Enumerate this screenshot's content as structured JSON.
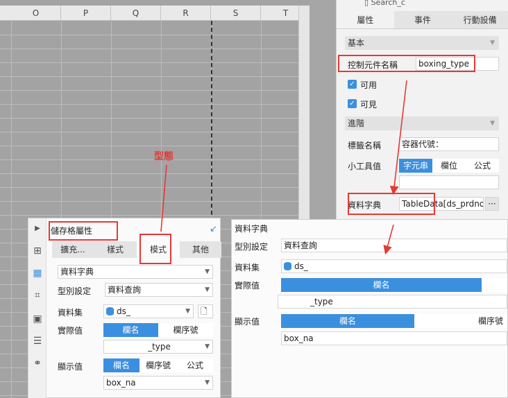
{
  "sheet": {
    "columns": [
      "O",
      "P",
      "Q",
      "R",
      "S",
      "T"
    ]
  },
  "right_panel": {
    "search_text": "Search_c",
    "tabs": [
      "屬性",
      "事件",
      "行動設備"
    ],
    "section_basic": "基本",
    "control_name_label": "控制元件名稱",
    "control_name_value": "boxing_type",
    "enabled_label": "可用",
    "visible_label": "可見",
    "section_advanced": "進階",
    "tag_label": "標籤名稱",
    "tag_value": "容器代號：",
    "tooltip_label": "小工具值",
    "tooltip_options": [
      "字元串",
      "欄位",
      "公式"
    ],
    "dict_label": "資料字典",
    "dict_value": "TableData[ds_prdno]]",
    "more_button": "···"
  },
  "left_panel": {
    "title": "儲存格屬性",
    "tabs": [
      "擴充...",
      "樣式",
      "模式",
      "其他"
    ],
    "dict_select": "資料字典",
    "type_label": "型別設定",
    "type_value": "資料查詢",
    "dataset_label": "資料集",
    "dataset_value": "ds_",
    "actual_label": "實際值",
    "actual_options": [
      "欄名",
      "欄序號"
    ],
    "actual_value": "_type",
    "display_label": "顯示值",
    "display_options": [
      "欄名",
      "欄序號",
      "公式"
    ],
    "display_value": "box_na"
  },
  "dict_popup": {
    "title": "資料字典",
    "type_label": "型別設定",
    "type_value": "資料查詢",
    "dataset_label": "資料集",
    "dataset_value": "ds_",
    "actual_label": "實際值",
    "actual_header": "欄名",
    "actual_value": "_type",
    "display_label": "顯示值",
    "display_header1": "欄名",
    "display_header2": "欄序號",
    "display_value": "box_na"
  },
  "annotation": {
    "type_label": "型態"
  },
  "colors": {
    "accent": "#3b8fdf",
    "annotation": "#e53935"
  }
}
